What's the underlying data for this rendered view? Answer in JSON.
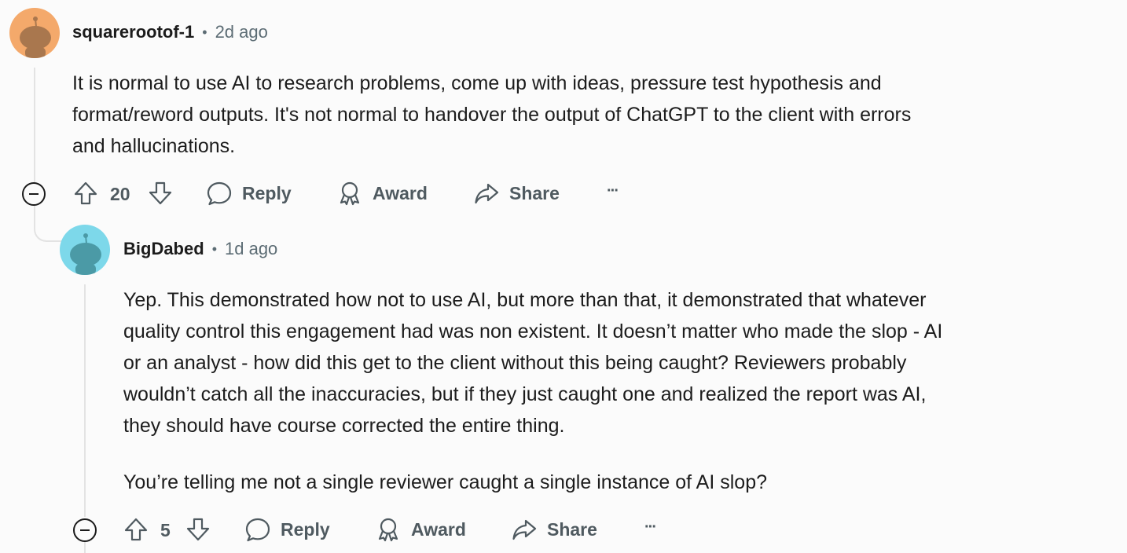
{
  "comments": [
    {
      "username": "squarerootof-1",
      "separator": "•",
      "time": "2d ago",
      "lines": [
        "It is normal to use AI to research problems, come up with ideas, pressure test hypothesis and",
        "format/reword outputs. It's not normal to handover the output of ChatGPT to the client with errors",
        "and hallucinations."
      ],
      "votes": "20",
      "reply_label": "Reply",
      "award_label": "Award",
      "share_label": "Share",
      "more_label": "···",
      "avatar_color": "#f4a96b"
    },
    {
      "username": "BigDabed",
      "separator": "•",
      "time": "1d ago",
      "lines": [
        "Yep. This demonstrated how not to use AI, but more than that, it demonstrated that whatever",
        "quality control this engagement had was non existent. It doesn’t matter who made the slop - AI",
        "or an analyst - how did this get to the client without this being caught? Reviewers probably",
        "wouldn’t catch all the inaccuracies, but if they just caught one and realized the report was AI,",
        "they should have course corrected the entire thing.",
        "You’re telling me not a single reviewer caught a single instance of AI slop?"
      ],
      "votes": "5",
      "reply_label": "Reply",
      "award_label": "Award",
      "share_label": "Share",
      "more_label": "···",
      "avatar_color": "#7dd8ea"
    }
  ]
}
